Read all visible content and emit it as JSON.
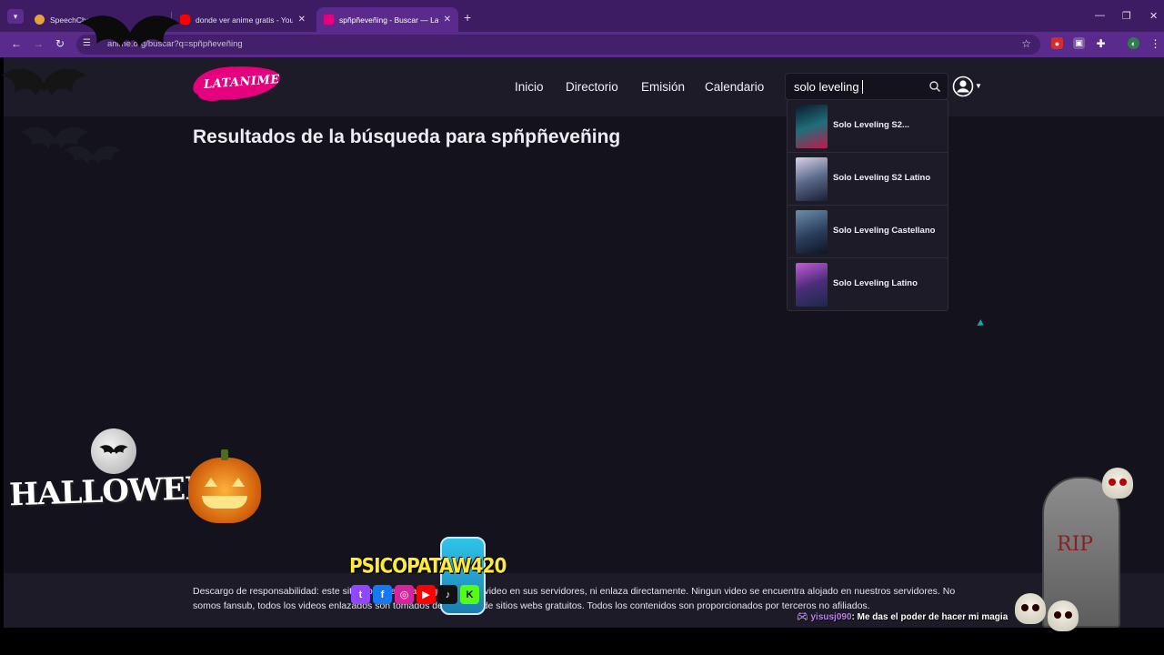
{
  "browser": {
    "tabs": [
      {
        "title": "SpeechChat",
        "color": "#e6a23c"
      },
      {
        "title": "donde ver anime gratis - YouTube",
        "color": "#ff0000"
      },
      {
        "title": "spñpñeveñing - Buscar — Latanime",
        "color": "#e6007e"
      }
    ],
    "new_tab": "+",
    "url": "anime.org/buscar?q=spñpñeveñing",
    "window_controls": {
      "minimize": "—",
      "restore": "❐",
      "close": "✕"
    }
  },
  "site": {
    "logo_text": "LATANIME",
    "nav": [
      "Inicio",
      "Directorio",
      "Emisión",
      "Calendario"
    ],
    "search": {
      "value": "solo leveling"
    },
    "results_title": "Resultados de la búsqueda para spñpñeveñing",
    "suggestions": [
      {
        "label": "Solo Leveling S2...",
        "color": "#1f6e7a"
      },
      {
        "label": "Solo Leveling S2 Latino",
        "color": "#5a6a8a"
      },
      {
        "label": "Solo Leveling Castellano",
        "color": "#2b3d5c"
      },
      {
        "label": "Solo Leveling Latino",
        "color": "#4b2d7a"
      }
    ],
    "disclaimer": "Descargo de responsabilidad: este sitio no almacena ningún archivo/video en sus servidores, ni enlaza directamente. Ningun video se encuentra alojado en nuestros servidores. No somos fansub, todos los videos enlazados son tomados de internet, de sitios webs gratuitos. Todos los contenidos son proporcionados por terceros no afiliados."
  },
  "overlay": {
    "halloween_text": "HALLOWEEN",
    "streamer_name": "PSICOPATAW420",
    "social_icons": [
      {
        "name": "twitch",
        "glyph": "t",
        "color": "#9146ff"
      },
      {
        "name": "facebook",
        "glyph": "f",
        "color": "#1877f2"
      },
      {
        "name": "instagram",
        "glyph": "◎",
        "color": "#d6249f"
      },
      {
        "name": "youtube",
        "glyph": "▶",
        "color": "#ff0000"
      },
      {
        "name": "tiktok",
        "glyph": "♪",
        "color": "#111111"
      },
      {
        "name": "kick",
        "glyph": "K",
        "color": "#53fc18"
      }
    ],
    "tomb_text": "RIP",
    "chat": {
      "user": "yisusj090",
      "message": ": Me das el poder de hacer mi magia"
    }
  }
}
